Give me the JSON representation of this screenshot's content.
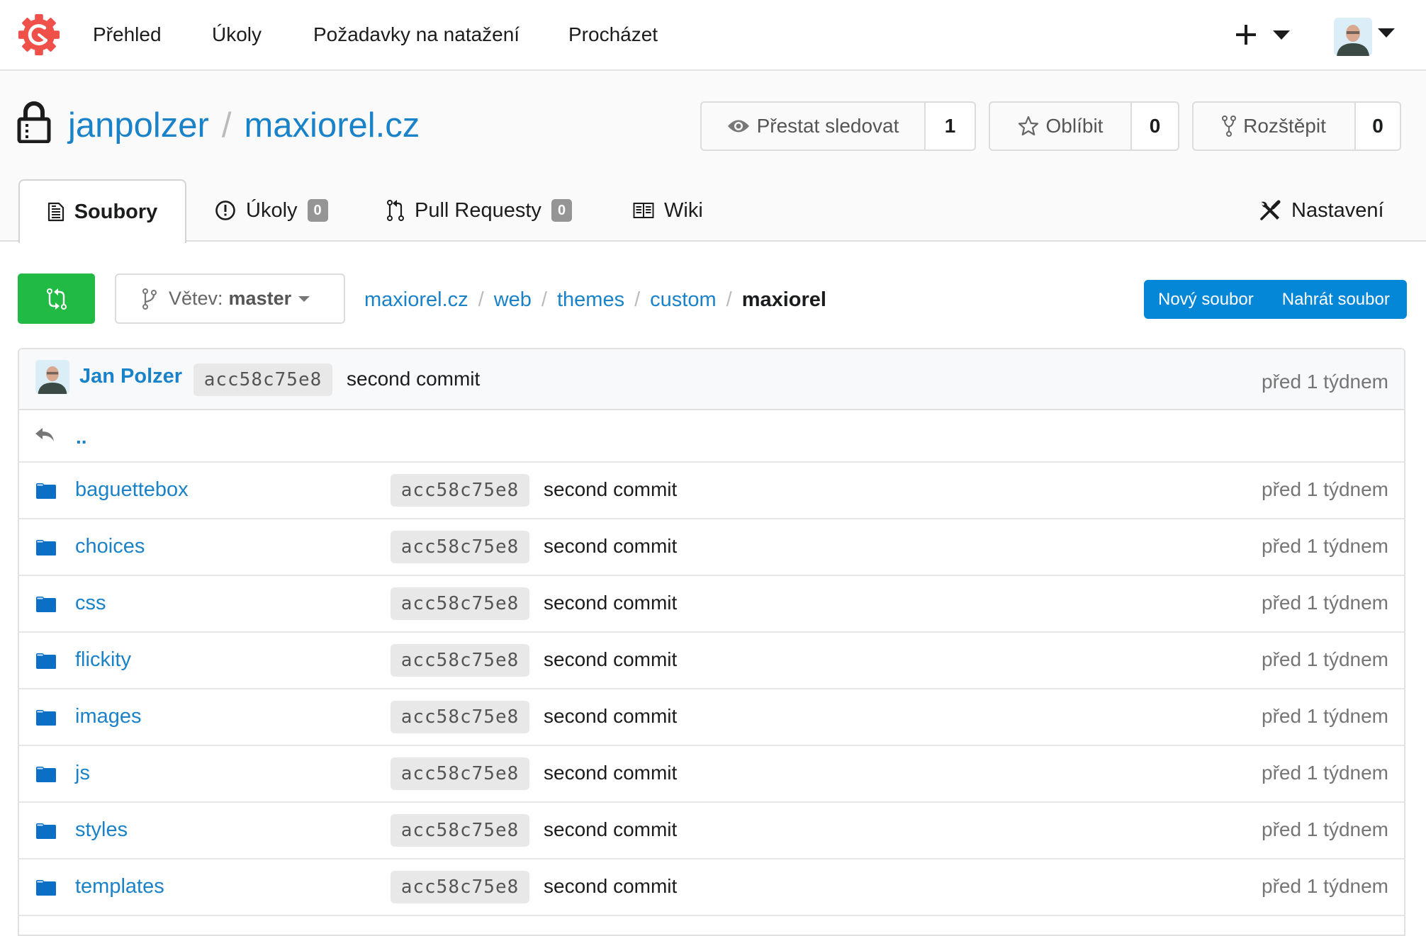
{
  "topnav": {
    "logo_icon": "gitea-gear-logo",
    "items": [
      {
        "label": "Přehled"
      },
      {
        "label": "Úkoly"
      },
      {
        "label": "Požadavky na natažení"
      },
      {
        "label": "Procházet"
      }
    ],
    "create_icon": "plus-icon",
    "user_avatar": "user-avatar"
  },
  "repo": {
    "owner": "janpolzer",
    "separator": "/",
    "name": "maxiorel.cz",
    "private_icon": "lock-icon",
    "watch": {
      "label": "Přestat sledovat",
      "count": "1",
      "icon": "eye-icon"
    },
    "star": {
      "label": "Oblíbit",
      "count": "0",
      "icon": "star-icon"
    },
    "fork": {
      "label": "Rozštěpit",
      "count": "0",
      "icon": "fork-icon"
    }
  },
  "tabs": [
    {
      "label": "Soubory",
      "icon": "file-text-icon",
      "active": true
    },
    {
      "label": "Úkoly",
      "icon": "issue-opened-icon",
      "badge": "0"
    },
    {
      "label": "Pull Requesty",
      "icon": "git-pull-request-icon",
      "badge": "0"
    },
    {
      "label": "Wiki",
      "icon": "book-icon"
    },
    {
      "label": "Nastavení",
      "icon": "tools-icon"
    }
  ],
  "toolbar": {
    "compare_icon": "compare-arrows-icon",
    "branch_prefix": "Větev:",
    "branch_name": "master",
    "breadcrumb": [
      "maxiorel.cz",
      "web",
      "themes",
      "custom"
    ],
    "breadcrumb_current": "maxiorel",
    "breadcrumb_divider": "/",
    "new_file": "Nový soubor",
    "upload_file": "Nahrát soubor"
  },
  "latest_commit": {
    "author": "Jan Polzer",
    "sha": "acc58c75e8",
    "message": "second commit",
    "age": "před 1 týdnem"
  },
  "parent_link": "..",
  "files": [
    {
      "name": "baguettebox",
      "sha": "acc58c75e8",
      "message": "second commit",
      "age": "před 1 týdnem"
    },
    {
      "name": "choices",
      "sha": "acc58c75e8",
      "message": "second commit",
      "age": "před 1 týdnem"
    },
    {
      "name": "css",
      "sha": "acc58c75e8",
      "message": "second commit",
      "age": "před 1 týdnem"
    },
    {
      "name": "flickity",
      "sha": "acc58c75e8",
      "message": "second commit",
      "age": "před 1 týdnem"
    },
    {
      "name": "images",
      "sha": "acc58c75e8",
      "message": "second commit",
      "age": "před 1 týdnem"
    },
    {
      "name": "js",
      "sha": "acc58c75e8",
      "message": "second commit",
      "age": "před 1 týdnem"
    },
    {
      "name": "styles",
      "sha": "acc58c75e8",
      "message": "second commit",
      "age": "před 1 týdnem"
    },
    {
      "name": "templates",
      "sha": "acc58c75e8",
      "message": "second commit",
      "age": "před 1 týdnem"
    }
  ],
  "colors": {
    "link": "#1a82c8",
    "green": "#21ba45",
    "blue": "#0587d8",
    "logo": "#f05a4e"
  }
}
